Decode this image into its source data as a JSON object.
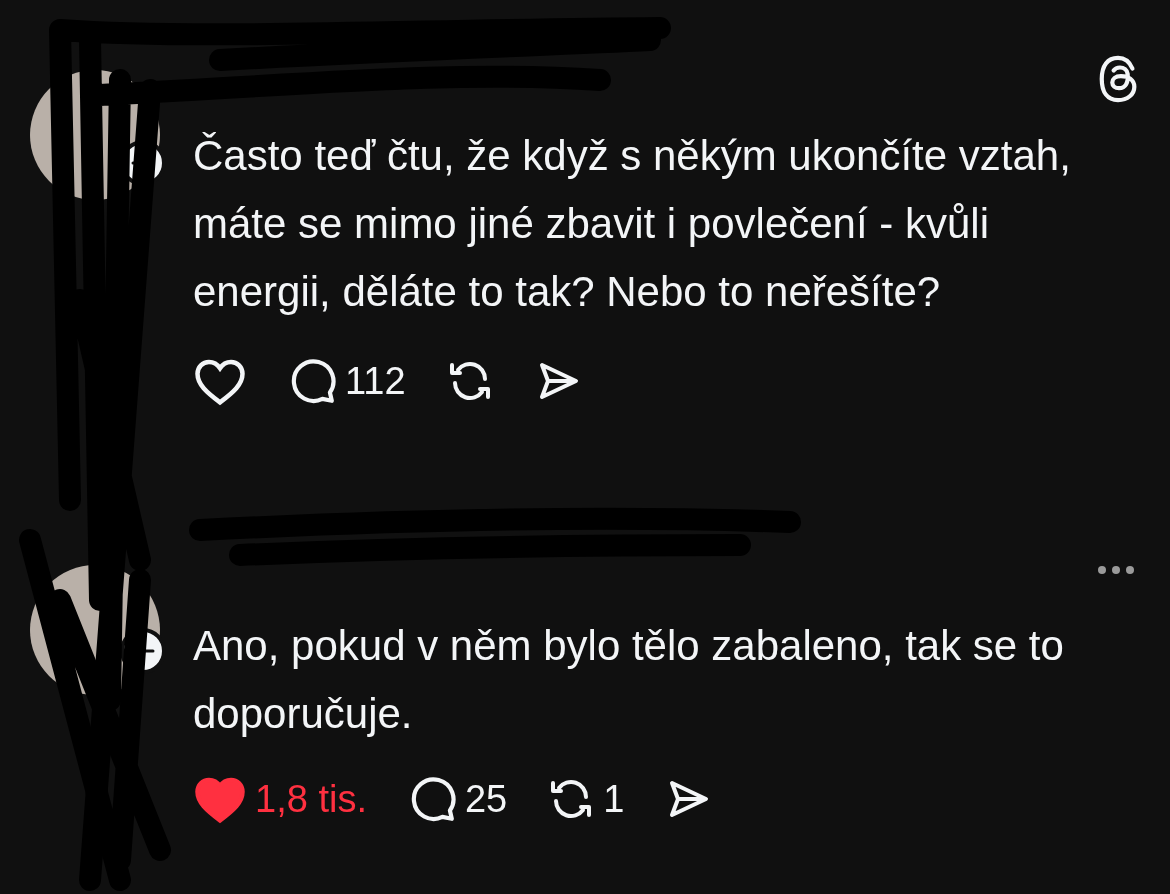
{
  "posts": [
    {
      "text": "Často teď čtu, že když s někým ukončíte vztah, máte se mimo jiné zbavit i povlečení - kvůli energii, děláte to tak? Nebo to neřešíte?",
      "corner": {
        "kind": "logo"
      },
      "liked": false,
      "actions": [
        {
          "kind": "like"
        },
        {
          "kind": "reply",
          "count": "112"
        },
        {
          "kind": "repost"
        },
        {
          "kind": "share"
        }
      ]
    },
    {
      "text": "Ano, pokud v něm bylo tělo zabaleno, tak se to doporučuje.",
      "corner": {
        "kind": "more"
      },
      "liked": true,
      "actions": [
        {
          "kind": "like",
          "count": "1,8 tis."
        },
        {
          "kind": "reply",
          "count": "25"
        },
        {
          "kind": "repost",
          "count": "1"
        },
        {
          "kind": "share"
        }
      ]
    }
  ]
}
